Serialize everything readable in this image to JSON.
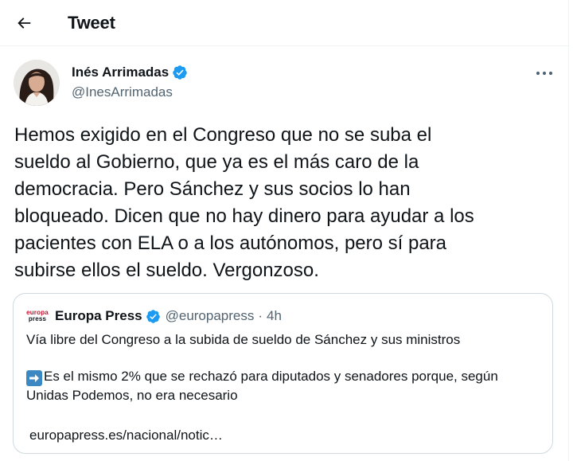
{
  "header": {
    "title": "Tweet"
  },
  "author": {
    "name": "Inés Arrimadas",
    "handle": "@InesArrimadas",
    "verified": true
  },
  "tweet": {
    "text": "Hemos exigido en el Congreso que no se suba el\nsueldo al Gobierno, que ya es el más caro de la\ndemocracia. Pero Sánchez y sus socios lo han\nbloqueado. Dicen que no hay dinero para ayudar a los\npacientes con ELA o a los autónomos, pero sí para\nsubirse ellos el sueldo. Vergonzoso."
  },
  "quote": {
    "logo_line1": "europa",
    "logo_line2": "press",
    "name": "Europa Press",
    "handle": "@europapress",
    "separator": "·",
    "time": "4h",
    "line1": "Vía libre del Congreso a la subida de sueldo de Sánchez y sus ministros",
    "line2": "Es el mismo 2% que se rechazó para diputados y senadores porque, según Unidas Podemos, no era necesario",
    "link": "europapress.es/nacional/notic…"
  },
  "icons": {
    "back": "back-arrow-icon",
    "verified": "verified-badge-icon",
    "more": "more-dots-icon",
    "arrow_emoji": "right-arrow-emoji-icon"
  },
  "colors": {
    "verified_blue": "#1d9bf0",
    "secondary_text": "#536471",
    "border": "#cfd9de"
  }
}
